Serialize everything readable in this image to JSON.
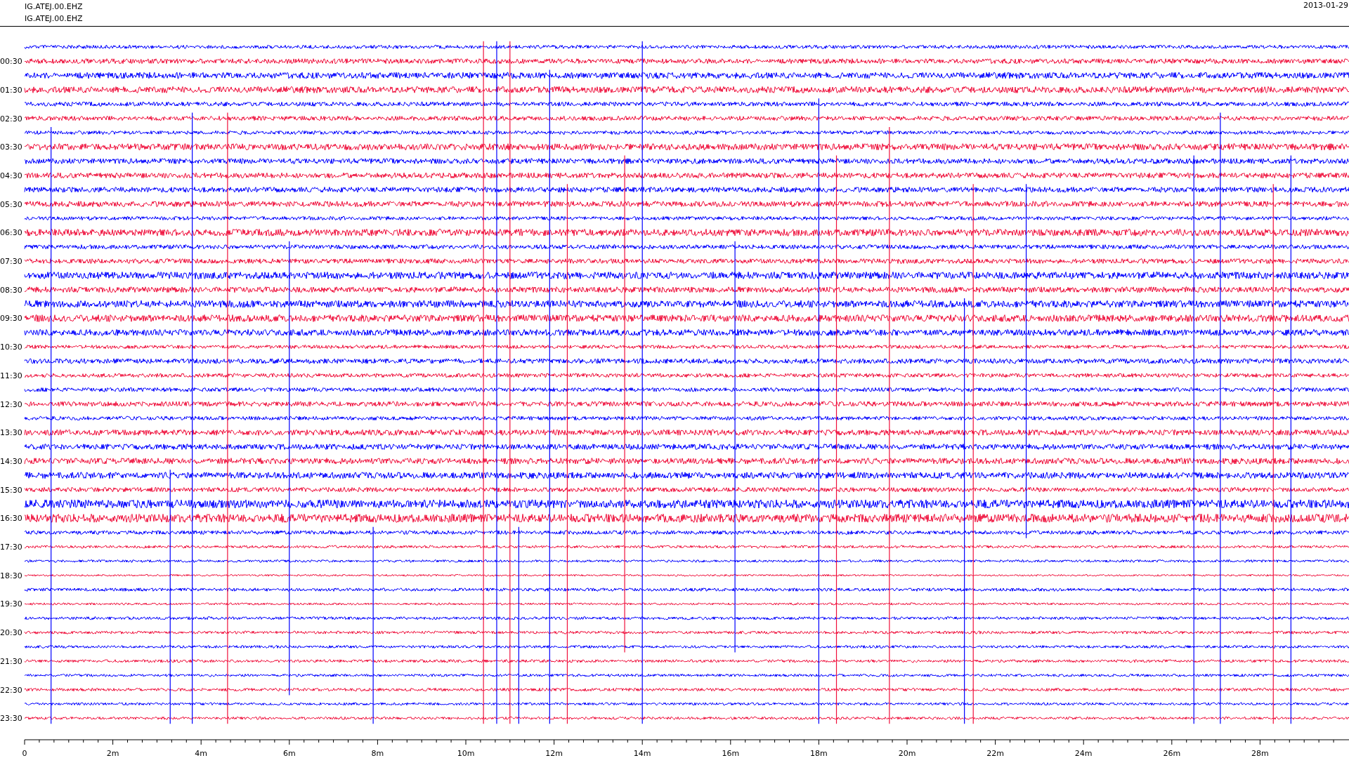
{
  "header": {
    "station_lines": [
      "IG.ATEJ.00.EHZ",
      "IG.ATEJ.00.EHZ"
    ],
    "date": "2013-01-29"
  },
  "rows": [
    {
      "color": "#0000ff"
    },
    {
      "color": "#f0103c",
      "label": "00:30"
    },
    {
      "color": "#0000ff"
    },
    {
      "color": "#f0103c",
      "label": "01:30"
    },
    {
      "color": "#0000ff"
    },
    {
      "color": "#f0103c",
      "label": "02:30"
    },
    {
      "color": "#0000ff"
    },
    {
      "color": "#f0103c",
      "label": "03:30"
    },
    {
      "color": "#0000ff"
    },
    {
      "color": "#f0103c",
      "label": "04:30"
    },
    {
      "color": "#0000ff"
    },
    {
      "color": "#f0103c",
      "label": "05:30"
    },
    {
      "color": "#0000ff"
    },
    {
      "color": "#f0103c",
      "label": "06:30"
    },
    {
      "color": "#0000ff"
    },
    {
      "color": "#f0103c",
      "label": "07:30"
    },
    {
      "color": "#0000ff"
    },
    {
      "color": "#f0103c",
      "label": "08:30"
    },
    {
      "color": "#0000ff"
    },
    {
      "color": "#f0103c",
      "label": "09:30"
    },
    {
      "color": "#0000ff"
    },
    {
      "color": "#f0103c",
      "label": "10:30"
    },
    {
      "color": "#0000ff"
    },
    {
      "color": "#f0103c",
      "label": "11:30"
    },
    {
      "color": "#0000ff"
    },
    {
      "color": "#f0103c",
      "label": "12:30"
    },
    {
      "color": "#0000ff"
    },
    {
      "color": "#f0103c",
      "label": "13:30"
    },
    {
      "color": "#0000ff"
    },
    {
      "color": "#f0103c",
      "label": "14:30"
    },
    {
      "color": "#0000ff"
    },
    {
      "color": "#f0103c",
      "label": "15:30"
    },
    {
      "color": "#0000ff"
    },
    {
      "color": "#f0103c",
      "label": "16:30"
    },
    {
      "color": "#0000ff"
    },
    {
      "color": "#f0103c",
      "label": "17:30"
    },
    {
      "color": "#0000ff"
    },
    {
      "color": "#f0103c",
      "label": "18:30"
    },
    {
      "color": "#0000ff"
    },
    {
      "color": "#f0103c",
      "label": "19:30"
    },
    {
      "color": "#0000ff"
    },
    {
      "color": "#f0103c",
      "label": "20:30"
    },
    {
      "color": "#0000ff"
    },
    {
      "color": "#f0103c",
      "label": "21:30"
    },
    {
      "color": "#0000ff"
    },
    {
      "color": "#f0103c",
      "label": "22:30"
    },
    {
      "color": "#0000ff"
    },
    {
      "color": "#f0103c",
      "label": "23:30"
    }
  ],
  "x_axis": {
    "labels": [
      "0",
      "2m",
      "4m",
      "6m",
      "8m",
      "10m",
      "12m",
      "14m",
      "16m",
      "18m",
      "20m",
      "22m",
      "24m",
      "26m",
      "28m"
    ]
  }
}
